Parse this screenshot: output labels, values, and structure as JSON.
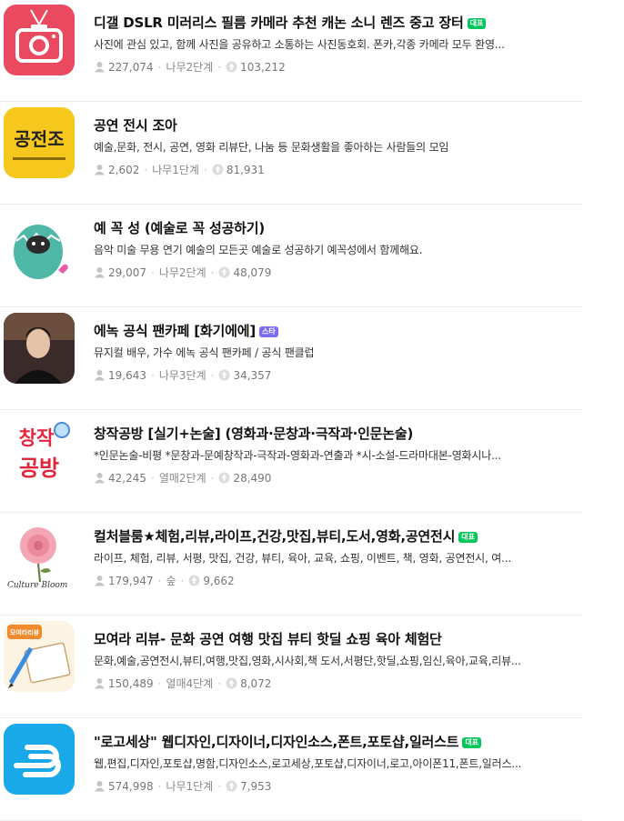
{
  "colors": {
    "badge_green": "#03c75a",
    "badge_purple": "#7b6cf0",
    "meta_gray": "#888888"
  },
  "cafes": [
    {
      "title": "디갤 DSLR 미러리스 필름 카메라 추천 캐논 소니 렌즈 중고 장터",
      "badge": "대표",
      "description": "사진에 관심 있고, 함께 사진을 공유하고 소통하는 사진동호회. 폰카,각종 카메라 모두 환영...",
      "members": "227,074",
      "level": "나무2단계",
      "ranking": "103,212",
      "thumb_text": ""
    },
    {
      "title": "공연 전시 조아",
      "badge": "",
      "description": "예술,문화, 전시, 공연, 영화 리뷰단, 나눔 등 문화생활을 좋아하는 사람들의 모임",
      "members": "2,602",
      "level": "나무1단계",
      "ranking": "81,931",
      "thumb_text": "공전조"
    },
    {
      "title": "예 꼭 성 (예술로 꼭 성공하기)",
      "badge": "",
      "description": "음악 미술 무용 연기 예술의 모든곳 예술로 성공하기 예꼭성에서 함께해요.",
      "members": "29,007",
      "level": "나무2단계",
      "ranking": "48,079",
      "thumb_text": ""
    },
    {
      "title": "에녹 공식 팬카페 [화기에에]",
      "badge": "스타",
      "description": "뮤지컬 배우, 가수 에녹 공식 팬카페 / 공식 팬클럽",
      "members": "19,643",
      "level": "나무3단계",
      "ranking": "34,357",
      "thumb_text": ""
    },
    {
      "title": "창작공방 [실기+논술] (영화과·문창과·극작과·인문논술)",
      "badge": "",
      "description": "*인문논술-비평 *문창과-문예창작과-극작과-영화과-연출과 *시-소설-드라마대본-영화시나...",
      "members": "42,245",
      "level": "열매2단계",
      "ranking": "28,490",
      "thumb_text": "창작공방"
    },
    {
      "title": "컬처블룸★체험,리뷰,라이프,건강,맛집,뷰티,도서,영화,공연전시",
      "badge": "대표",
      "description": "라이프, 체험, 리뷰, 서평, 맛집, 건강, 뷰티, 육아, 교육, 쇼핑, 이벤트, 책, 영화, 공연전시, 여...",
      "members": "179,947",
      "level": "숲",
      "ranking": "9,662",
      "thumb_text": "Culture Bloom"
    },
    {
      "title": "모여라 리뷰- 문화 공연 여행 맛집 뷰티 핫딜 쇼핑 육아 체험단",
      "badge": "",
      "description": "문화,예술,공연전시,뷰티,여행,맛집,영화,시사회,책 도서,서평단,핫딜,쇼핑,임신,육아,교육,리뷰...",
      "members": "150,489",
      "level": "열매4단계",
      "ranking": "8,072",
      "thumb_text": "모여라리뷰"
    },
    {
      "title": "\"로고세상\" 웹디자인,디자이너,디자인소스,폰트,포토샵,일러스트",
      "badge": "대표",
      "description": "웹,편집,디자인,포토샵,명함,디자인소스,로고세상,포토샵,디자이너,로고,아이폰11,폰트,일러스...",
      "members": "574,998",
      "level": "나무1단계",
      "ranking": "7,953",
      "thumb_text": ""
    }
  ]
}
